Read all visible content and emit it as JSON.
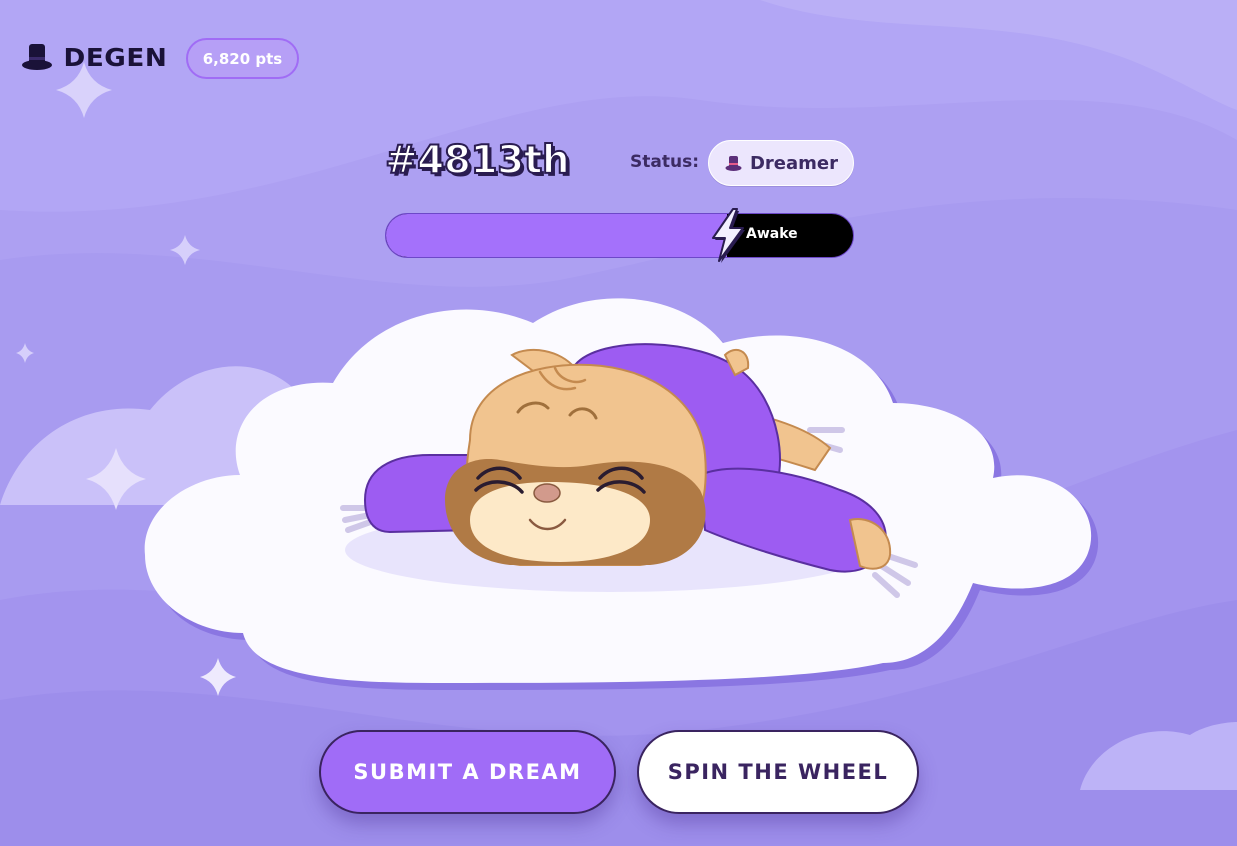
{
  "header": {
    "brand_name": "DEGEN",
    "points": "6,820 pts"
  },
  "rank": "#4813th",
  "status": {
    "label": "Status:",
    "value": "Dreamer"
  },
  "progress": {
    "label": "Awake",
    "level_percent": 73
  },
  "actions": {
    "submit_label": "SUBMIT A DREAM",
    "spin_label": "SPIN THE WHEEL"
  },
  "colors": {
    "background": "#a89bf0",
    "accent_purple": "#a06cf7",
    "dark_ink": "#3a2460",
    "cloud_white": "#fbfaff"
  },
  "icons": {
    "brand": "top-hat-icon",
    "status": "top-hat-icon",
    "progress": "lightning-bolt-icon"
  }
}
